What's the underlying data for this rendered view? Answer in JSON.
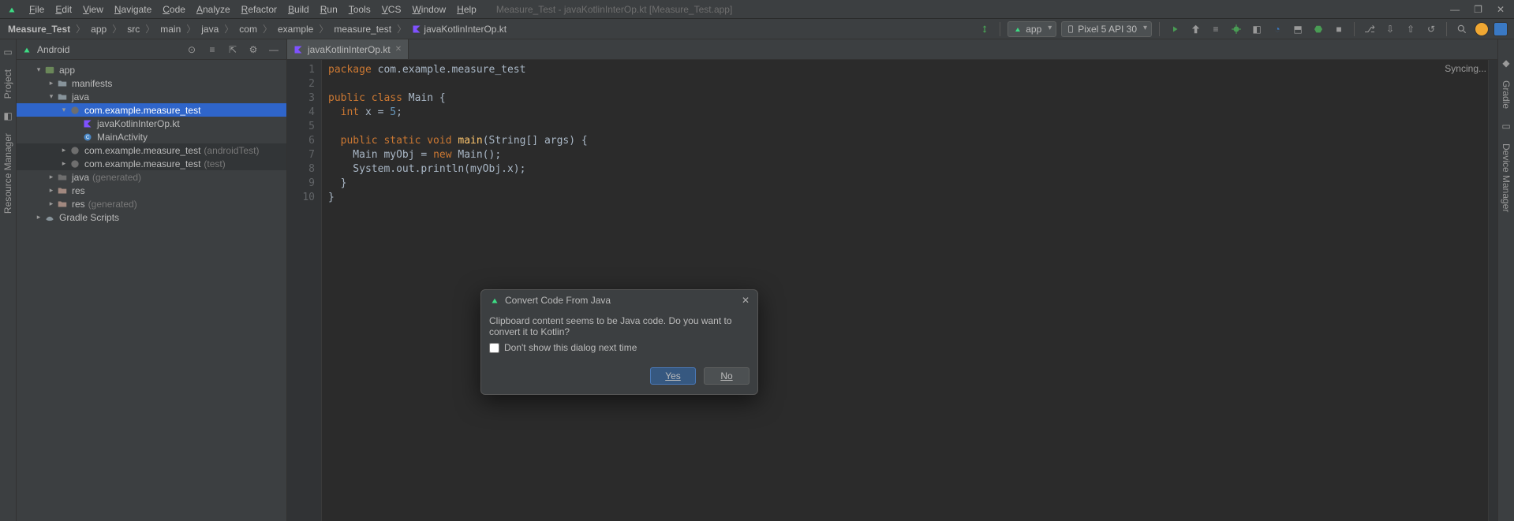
{
  "title_center": "Measure_Test - javaKotlinInterOp.kt [Measure_Test.app]",
  "menu": [
    "File",
    "Edit",
    "View",
    "Navigate",
    "Code",
    "Analyze",
    "Refactor",
    "Build",
    "Run",
    "Tools",
    "VCS",
    "Window",
    "Help"
  ],
  "breadcrumbs": [
    "Measure_Test",
    "app",
    "src",
    "main",
    "java",
    "com",
    "example",
    "measure_test",
    "javaKotlinInterOp.kt"
  ],
  "run_config": "app",
  "device_config": "Pixel 5 API 30",
  "sync_label": "Syncing...",
  "sidebar": {
    "mode": "Android",
    "items": [
      {
        "indent": 1,
        "arrow": "▾",
        "icon": "module",
        "label": "app"
      },
      {
        "indent": 2,
        "arrow": "▸",
        "icon": "folder",
        "label": "manifests"
      },
      {
        "indent": 2,
        "arrow": "▾",
        "icon": "folder",
        "label": "java"
      },
      {
        "indent": 3,
        "arrow": "▾",
        "icon": "package",
        "label": "com.example.measure_test",
        "selected": true
      },
      {
        "indent": 4,
        "arrow": " ",
        "icon": "kotlin-file",
        "label": "javaKotlinInterOp.kt"
      },
      {
        "indent": 4,
        "arrow": " ",
        "icon": "class",
        "label": "MainActivity"
      },
      {
        "indent": 3,
        "arrow": "▸",
        "icon": "package",
        "label": "com.example.measure_test",
        "suffix": "(androidTest)",
        "dim": true
      },
      {
        "indent": 3,
        "arrow": "▸",
        "icon": "package",
        "label": "com.example.measure_test",
        "suffix": "(test)",
        "dim": true
      },
      {
        "indent": 2,
        "arrow": "▸",
        "icon": "folder-gen",
        "label": "java",
        "suffix": "(generated)"
      },
      {
        "indent": 2,
        "arrow": "▸",
        "icon": "folder-res",
        "label": "res"
      },
      {
        "indent": 2,
        "arrow": "▸",
        "icon": "folder-res",
        "label": "res",
        "suffix": "(generated)"
      },
      {
        "indent": 1,
        "arrow": "▸",
        "icon": "gradle",
        "label": "Gradle Scripts"
      }
    ]
  },
  "editor": {
    "tab": "javaKotlinInterOp.kt",
    "lines": [
      {
        "n": 1,
        "html": "<span class='kw'>package</span> com.example.measure_test"
      },
      {
        "n": 2,
        "html": ""
      },
      {
        "n": 3,
        "html": "<span class='kw'>public</span> <span class='kw'>class</span> Main {"
      },
      {
        "n": 4,
        "html": "  <span class='kw'>int</span> x = <span class='num'>5</span>;"
      },
      {
        "n": 5,
        "html": ""
      },
      {
        "n": 6,
        "html": "  <span class='kw'>public static void</span> <span class='fn'>main</span>(String[] args) {"
      },
      {
        "n": 7,
        "html": "    Main myObj = <span class='kw'>new</span> Main();"
      },
      {
        "n": 8,
        "html": "    System.out.println(myObj.x);"
      },
      {
        "n": 9,
        "html": "  }"
      },
      {
        "n": 10,
        "html": "}"
      }
    ]
  },
  "dialog": {
    "title": "Convert Code From Java",
    "message": "Clipboard content seems to be Java code. Do you want to convert it to Kotlin?",
    "checkbox": "Don't show this dialog next time",
    "yes": "Yes",
    "no": "No"
  },
  "left_tabs": [
    "Project",
    "Resource Manager"
  ],
  "right_tabs": [
    "Gradle",
    "Device Manager"
  ]
}
